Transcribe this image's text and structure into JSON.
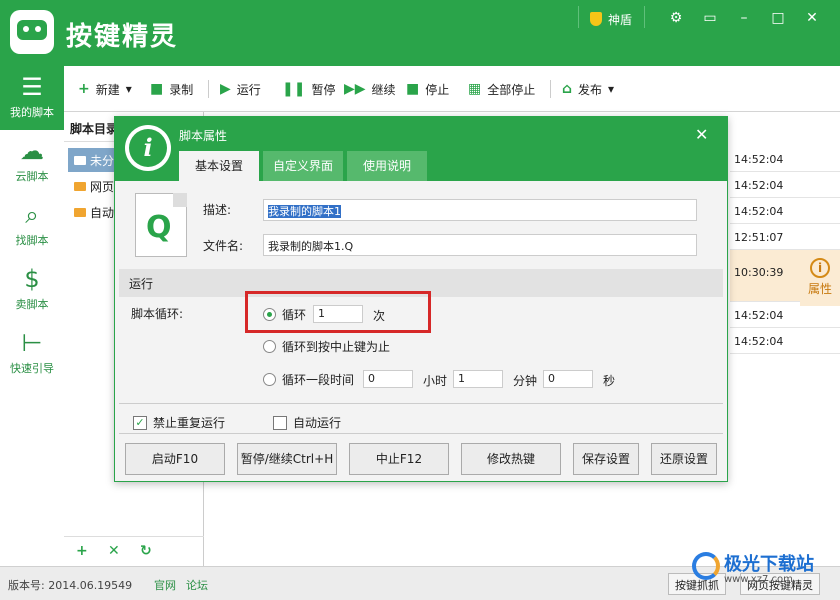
{
  "app": {
    "title": "按键精灵",
    "shield_label": "神盾"
  },
  "titlebar_icons": [
    "gear-icon",
    "menu-icon",
    "minimize-icon",
    "maximize-icon",
    "close-icon"
  ],
  "sidebar": {
    "items": [
      {
        "label": "我的脚本",
        "icon": "list-icon",
        "active": true
      },
      {
        "label": "云脚本",
        "icon": "cloud-icon"
      },
      {
        "label": "找脚本",
        "icon": "search-icon"
      },
      {
        "label": "卖脚本",
        "icon": "dollar-icon"
      },
      {
        "label": "快速引导",
        "icon": "signpost-icon"
      }
    ]
  },
  "toolbar": {
    "new": "新建",
    "record": "录制",
    "run": "运行",
    "pause": "暂停",
    "resume": "继续",
    "stop": "停止",
    "stop_all": "全部停止",
    "publish": "发布"
  },
  "left_pane": {
    "header": "脚本目录",
    "folders": [
      "未分",
      "网页",
      "自动"
    ]
  },
  "list_rows": [
    "14:52:04",
    "14:52:04",
    "14:52:04",
    "12:51:07",
    "10:30:39",
    "14:52:04",
    "14:52:04"
  ],
  "props_label": "属性",
  "status": {
    "version": "版本号: 2014.06.19549",
    "link_official": "官网",
    "link_forum": "论坛",
    "btn_capture": "按键抓抓",
    "btn_web": "网页按键精灵"
  },
  "watermark": {
    "title": "极光下载站",
    "site": "www.xz7.com"
  },
  "dialog": {
    "title": "脚本属性",
    "tabs": [
      "基本设置",
      "自定义界面",
      "使用说明"
    ],
    "desc_label": "描述:",
    "desc_value": "我录制的脚本1",
    "file_label": "文件名:",
    "file_value": "我录制的脚本1.Q",
    "section_run": "运行",
    "loop_label": "脚本循环:",
    "loop_option_1": "循环",
    "loop_count": "1",
    "loop_unit": "次",
    "loop_option_2": "循环到按中止键为止",
    "loop_option_3": "循环一段时间",
    "time_h": "0",
    "time_h_unit": "小时",
    "time_m": "1",
    "time_m_unit": "分钟",
    "time_s": "0",
    "time_s_unit": "秒",
    "check_no_repeat": "禁止重复运行",
    "check_auto_run": "自动运行",
    "buttons": {
      "start": "启动F10",
      "pause": "暂停/继续Ctrl+H",
      "stop": "中止F12",
      "hotkey": "修改热键",
      "save": "保存设置",
      "restore": "还原设置"
    }
  }
}
